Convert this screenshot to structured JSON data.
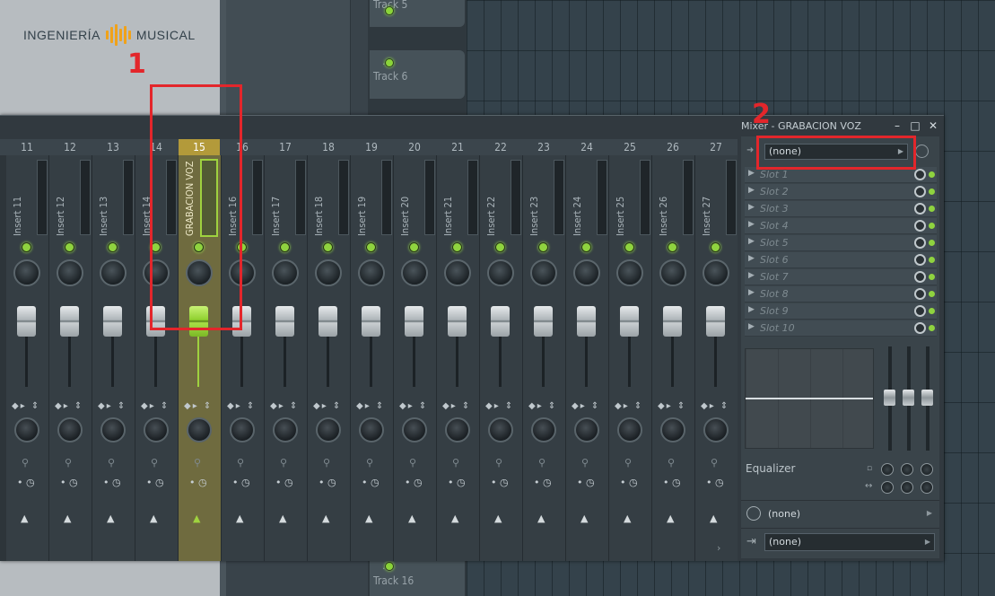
{
  "logo": {
    "left_text": "INGENIERÍA",
    "right_text": "MUSICAL",
    "bars_color": "#f0a21a"
  },
  "playlist": {
    "tracks": [
      {
        "dots": "...",
        "label": "Track 5"
      },
      {
        "dots": "...",
        "label": "Track 6"
      }
    ],
    "bottom_track": {
      "dots": "...",
      "label": "Track 16"
    }
  },
  "mixer": {
    "title": "Mixer - GRABACION VOZ",
    "window_controls": {
      "minimize": "–",
      "maximize": "□",
      "close": "✕"
    },
    "selected_insert": 15,
    "accent_color": "#9fd23f",
    "inserts": [
      {
        "number": "11",
        "name": "Insert 11"
      },
      {
        "number": "12",
        "name": "Insert 12"
      },
      {
        "number": "13",
        "name": "Insert 13"
      },
      {
        "number": "14",
        "name": "Insert 14"
      },
      {
        "number": "15",
        "name": "GRABACION VOZ"
      },
      {
        "number": "16",
        "name": "Insert 16"
      },
      {
        "number": "17",
        "name": "Insert 17"
      },
      {
        "number": "18",
        "name": "Insert 18"
      },
      {
        "number": "19",
        "name": "Insert 19"
      },
      {
        "number": "20",
        "name": "Insert 20"
      },
      {
        "number": "21",
        "name": "Insert 21"
      },
      {
        "number": "22",
        "name": "Insert 22"
      },
      {
        "number": "23",
        "name": "Insert 23"
      },
      {
        "number": "24",
        "name": "Insert 24"
      },
      {
        "number": "25",
        "name": "Insert 25"
      },
      {
        "number": "26",
        "name": "Insert 26"
      },
      {
        "number": "27",
        "name": "Insert 27"
      }
    ],
    "strip_glyphs": {
      "pan_arrows": "◆▸ ⇕",
      "dot_row": "• ◷",
      "up_arrow": "▲",
      "mini_icon": "⚲"
    }
  },
  "effects_panel": {
    "preset_value": "(none)",
    "slots": [
      "Slot 1",
      "Slot 2",
      "Slot 3",
      "Slot 4",
      "Slot 5",
      "Slot 6",
      "Slot 7",
      "Slot 8",
      "Slot 9",
      "Slot 10"
    ],
    "equalizer_label": "Equalizer",
    "input_route_value": "(none)",
    "output_route_value": "(none)"
  },
  "annotations": {
    "first": "1",
    "second": "2",
    "color": "#e3262b"
  }
}
